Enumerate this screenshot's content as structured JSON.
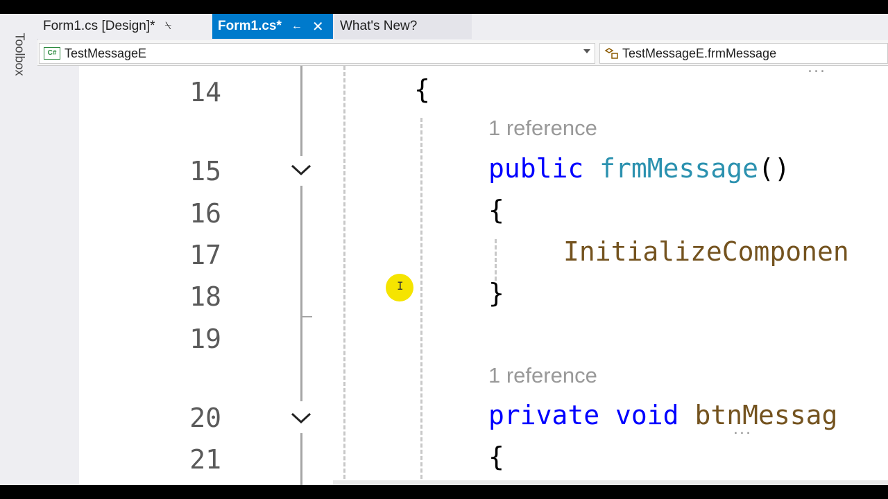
{
  "toolbox": {
    "label": "Toolbox"
  },
  "tabs": [
    {
      "label": "Form1.cs [Design]*",
      "pin": "⍀"
    },
    {
      "label": "Form1.cs*",
      "pin": "←",
      "close": "✕"
    },
    {
      "label": "What's New?"
    }
  ],
  "navbar": {
    "class_combo": "TestMessageE",
    "member_combo": "TestMessageE.frmMessage"
  },
  "editor": {
    "line_numbers": [
      "14",
      "15",
      "16",
      "17",
      "18",
      "19",
      "20",
      "21"
    ],
    "codelens_1": "1 reference",
    "codelens_2": "1 reference",
    "lines": {
      "l14_brace": "{",
      "l15_kw": "public",
      "l15_name": "frmMessage",
      "l15_parens": "()",
      "l16_brace": "{",
      "l17_call": "InitializeComponen",
      "l18_brace": "}",
      "l20_kw1": "private",
      "l20_kw2": "void",
      "l20_name": "btnMessag",
      "l21_brace": "{"
    },
    "top_dots": "...",
    "name_dots": "..."
  },
  "colors": {
    "keyword": "#0000ff",
    "type": "#2b91af",
    "method": "#74531f",
    "active_tab": "#007acc",
    "cursor_highlight": "#f5e400"
  }
}
